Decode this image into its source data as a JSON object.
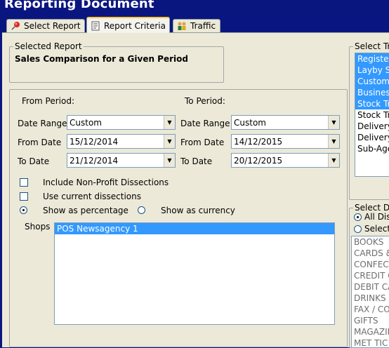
{
  "window": {
    "title": "Reporting Document"
  },
  "tabs": [
    {
      "label": "Select Report",
      "accel": "S",
      "icon": "pushpin-icon"
    },
    {
      "label": "Report Criteria",
      "accel": "C",
      "icon": "report-document-icon"
    },
    {
      "label": "Traffic",
      "accel": "T",
      "icon": "people-icon"
    }
  ],
  "selected_report": {
    "group_label": "Selected Report",
    "name": "Sales Comparison for a Given Period"
  },
  "from_period": {
    "heading": "From Period:",
    "date_range_label": "Date Range",
    "date_range_value": "Custom",
    "from_date_label": "From Date",
    "from_date_value": "15/12/2014",
    "to_date_label": "To Date",
    "to_date_value": "21/12/2014"
  },
  "to_period": {
    "heading": "To Period:",
    "date_range_label": "Date Range",
    "date_range_value": "Custom",
    "from_date_label": "From Date",
    "from_date_value": "14/12/2015",
    "to_date_label": "To Date",
    "to_date_value": "20/12/2015"
  },
  "options": {
    "include_non_profit": "Include Non-Profit Dissections",
    "use_current": "Use current dissections",
    "show_percentage": "Show as percentage",
    "show_currency": "Show as currency"
  },
  "shops": {
    "label": "Shops",
    "items": [
      "POS Newsagency 1"
    ]
  },
  "select_transactions": {
    "group_label": "Select Tr",
    "items": [
      {
        "label": "Register",
        "selected": true
      },
      {
        "label": "Layby Sa",
        "selected": true
      },
      {
        "label": "Custome",
        "selected": true
      },
      {
        "label": "Business",
        "selected": true
      },
      {
        "label": "Stock Tr",
        "selected": true
      },
      {
        "label": "Stock Tr",
        "selected": false
      },
      {
        "label": "Delivery",
        "selected": false
      },
      {
        "label": "Delivery",
        "selected": false
      },
      {
        "label": "Sub-Age",
        "selected": false
      }
    ]
  },
  "select_dissections": {
    "group_label": "Select Di",
    "radio_all": "All Dis",
    "radio_select": "Select",
    "items": [
      "BOOKS",
      "CARDS &",
      "CONFECT",
      "CREDIT C",
      "DEBIT CA",
      "DRINKS",
      "FAX / CO",
      "GIFTS",
      "MAGAZIN",
      "MET TIC"
    ]
  }
}
